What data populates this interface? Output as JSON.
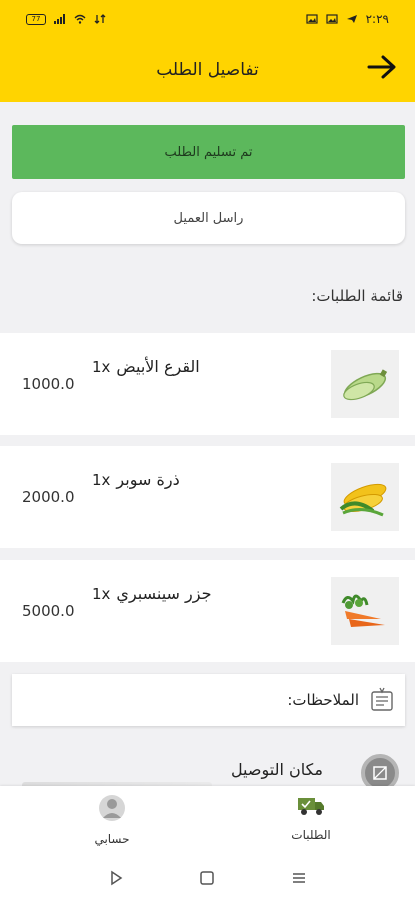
{
  "status_bar": {
    "time": "٢:٢٩",
    "battery": "77",
    "left_icons": [
      "battery-icon",
      "signal-icon",
      "wifi-icon",
      "data-icon"
    ],
    "right_icons": [
      "gallery-icon",
      "gallery-icon",
      "telegram-icon",
      "clock-icon"
    ]
  },
  "header": {
    "title": "تفاصيل الطلب",
    "back_icon": "arrow-right-icon",
    "color": "#ffd400"
  },
  "actions": {
    "delivered": "تم تسليم الطلب",
    "delivered_color": "#5cb85c",
    "contact_customer": "راسل العميل"
  },
  "orders_list": {
    "title": "قائمة الطلبات:",
    "items": [
      {
        "name": "القرع الأبيض",
        "qty": "1x",
        "price": "1000.0",
        "image": "zucchini"
      },
      {
        "name": "ذرة سوبر",
        "qty": "1x",
        "price": "2000.0",
        "image": "corn"
      },
      {
        "name": "جزر سينسبري",
        "qty": "1x",
        "price": "5000.0",
        "image": "carrots"
      }
    ]
  },
  "notes": {
    "label": "الملاحظات:",
    "icon": "notes-icon"
  },
  "delivery": {
    "label": "مكان التوصيل",
    "icon": "map-icon"
  },
  "bottom_nav": {
    "orders": "الطلبات",
    "account": "حسابي"
  },
  "system_nav": [
    "back-triangle-icon",
    "home-square-icon",
    "menu-lines-icon"
  ]
}
